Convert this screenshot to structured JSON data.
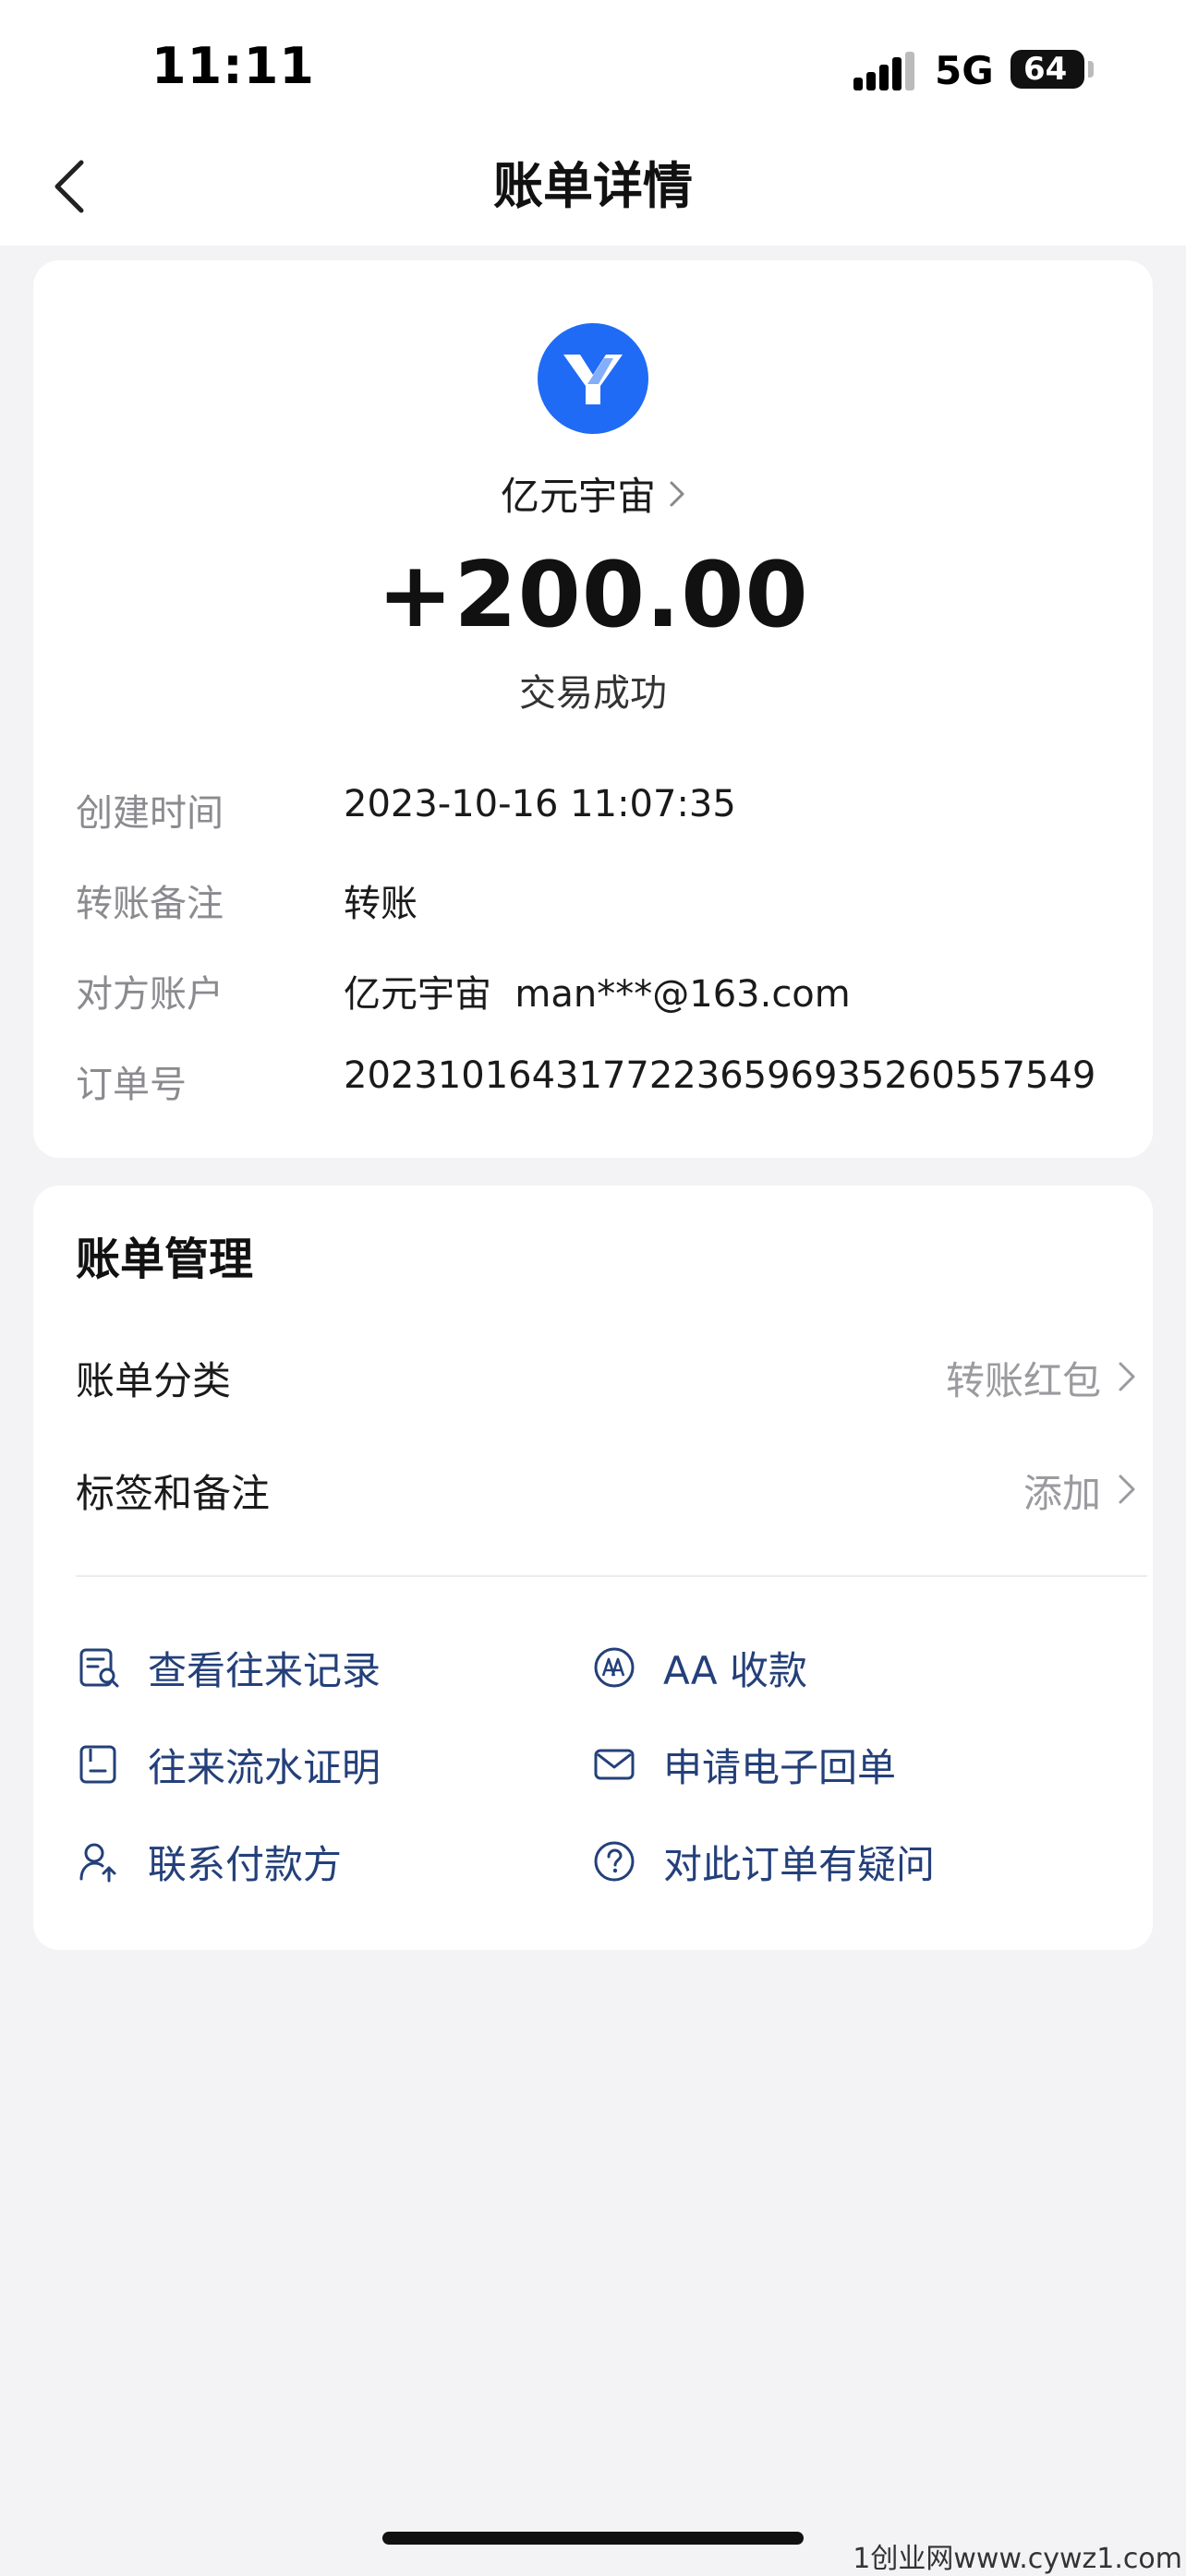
{
  "status_bar": {
    "time": "11:11",
    "network": "5G",
    "battery": "64"
  },
  "nav": {
    "title": "账单详情"
  },
  "merchant": {
    "name": "亿元宇宙",
    "amount": "+200.00",
    "status": "交易成功"
  },
  "details": [
    {
      "label": "创建时间",
      "value": "2023-10-16 11:07:35"
    },
    {
      "label": "转账备注",
      "value": "转账"
    },
    {
      "label": "对方账户",
      "value": "亿元宇宙  man***@163.com"
    },
    {
      "label": "订单号",
      "value": "2023101643177223659693526055754​9"
    }
  ],
  "management": {
    "title": "账单管理",
    "category": {
      "label": "账单分类",
      "value": "转账红包"
    },
    "tags": {
      "label": "标签和备注",
      "value": "添加"
    }
  },
  "actions": {
    "view_records": "查看往来记录",
    "aa_collect": "AA 收款",
    "flow_proof": "往来流水证明",
    "receipt": "申请电子回单",
    "contact_payer": "联系付款方",
    "question": "对此订单有疑问"
  },
  "colors": {
    "brand_blue": "#1f6bf5",
    "action_text": "#24407a"
  },
  "watermark": "1创业网www.cywz1.com"
}
